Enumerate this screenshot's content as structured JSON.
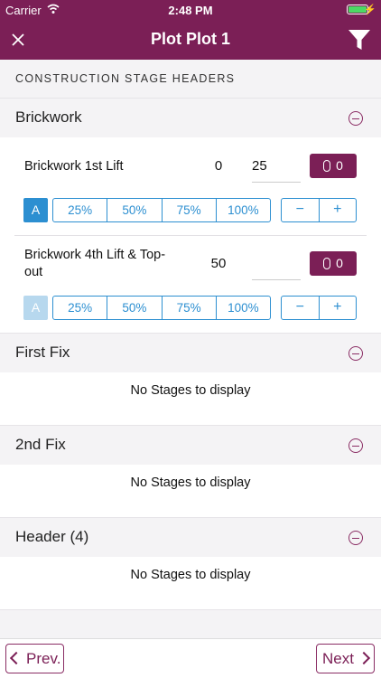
{
  "status": {
    "carrier": "Carrier",
    "time": "2:48 PM"
  },
  "nav": {
    "title": "Plot Plot 1"
  },
  "page_heading": "CONSTRUCTION STAGE HEADERS",
  "sections": [
    {
      "name": "Brickwork",
      "stages": [
        {
          "label": "Brickwork 1st Lift",
          "value": "0",
          "input": "25",
          "attachments": "0",
          "a_label": "A",
          "percentages": [
            "25%",
            "50%",
            "75%",
            "100%"
          ],
          "minus": "−",
          "plus": "+"
        },
        {
          "label": "Brickwork 4th Lift & Top-out",
          "value": "50",
          "input": "",
          "attachments": "0",
          "a_label": "A",
          "percentages": [
            "25%",
            "50%",
            "75%",
            "100%"
          ],
          "minus": "−",
          "plus": "+"
        }
      ]
    },
    {
      "name": "First Fix",
      "empty_text": "No Stages to display"
    },
    {
      "name": "2nd Fix",
      "empty_text": "No Stages to display"
    },
    {
      "name": "Header (4)",
      "empty_text": "No Stages to display"
    }
  ],
  "footer": {
    "prev_label": "Prev.",
    "next_label": "Next"
  },
  "colors": {
    "brand": "#7b1f56",
    "accent": "#2c8fd1"
  }
}
